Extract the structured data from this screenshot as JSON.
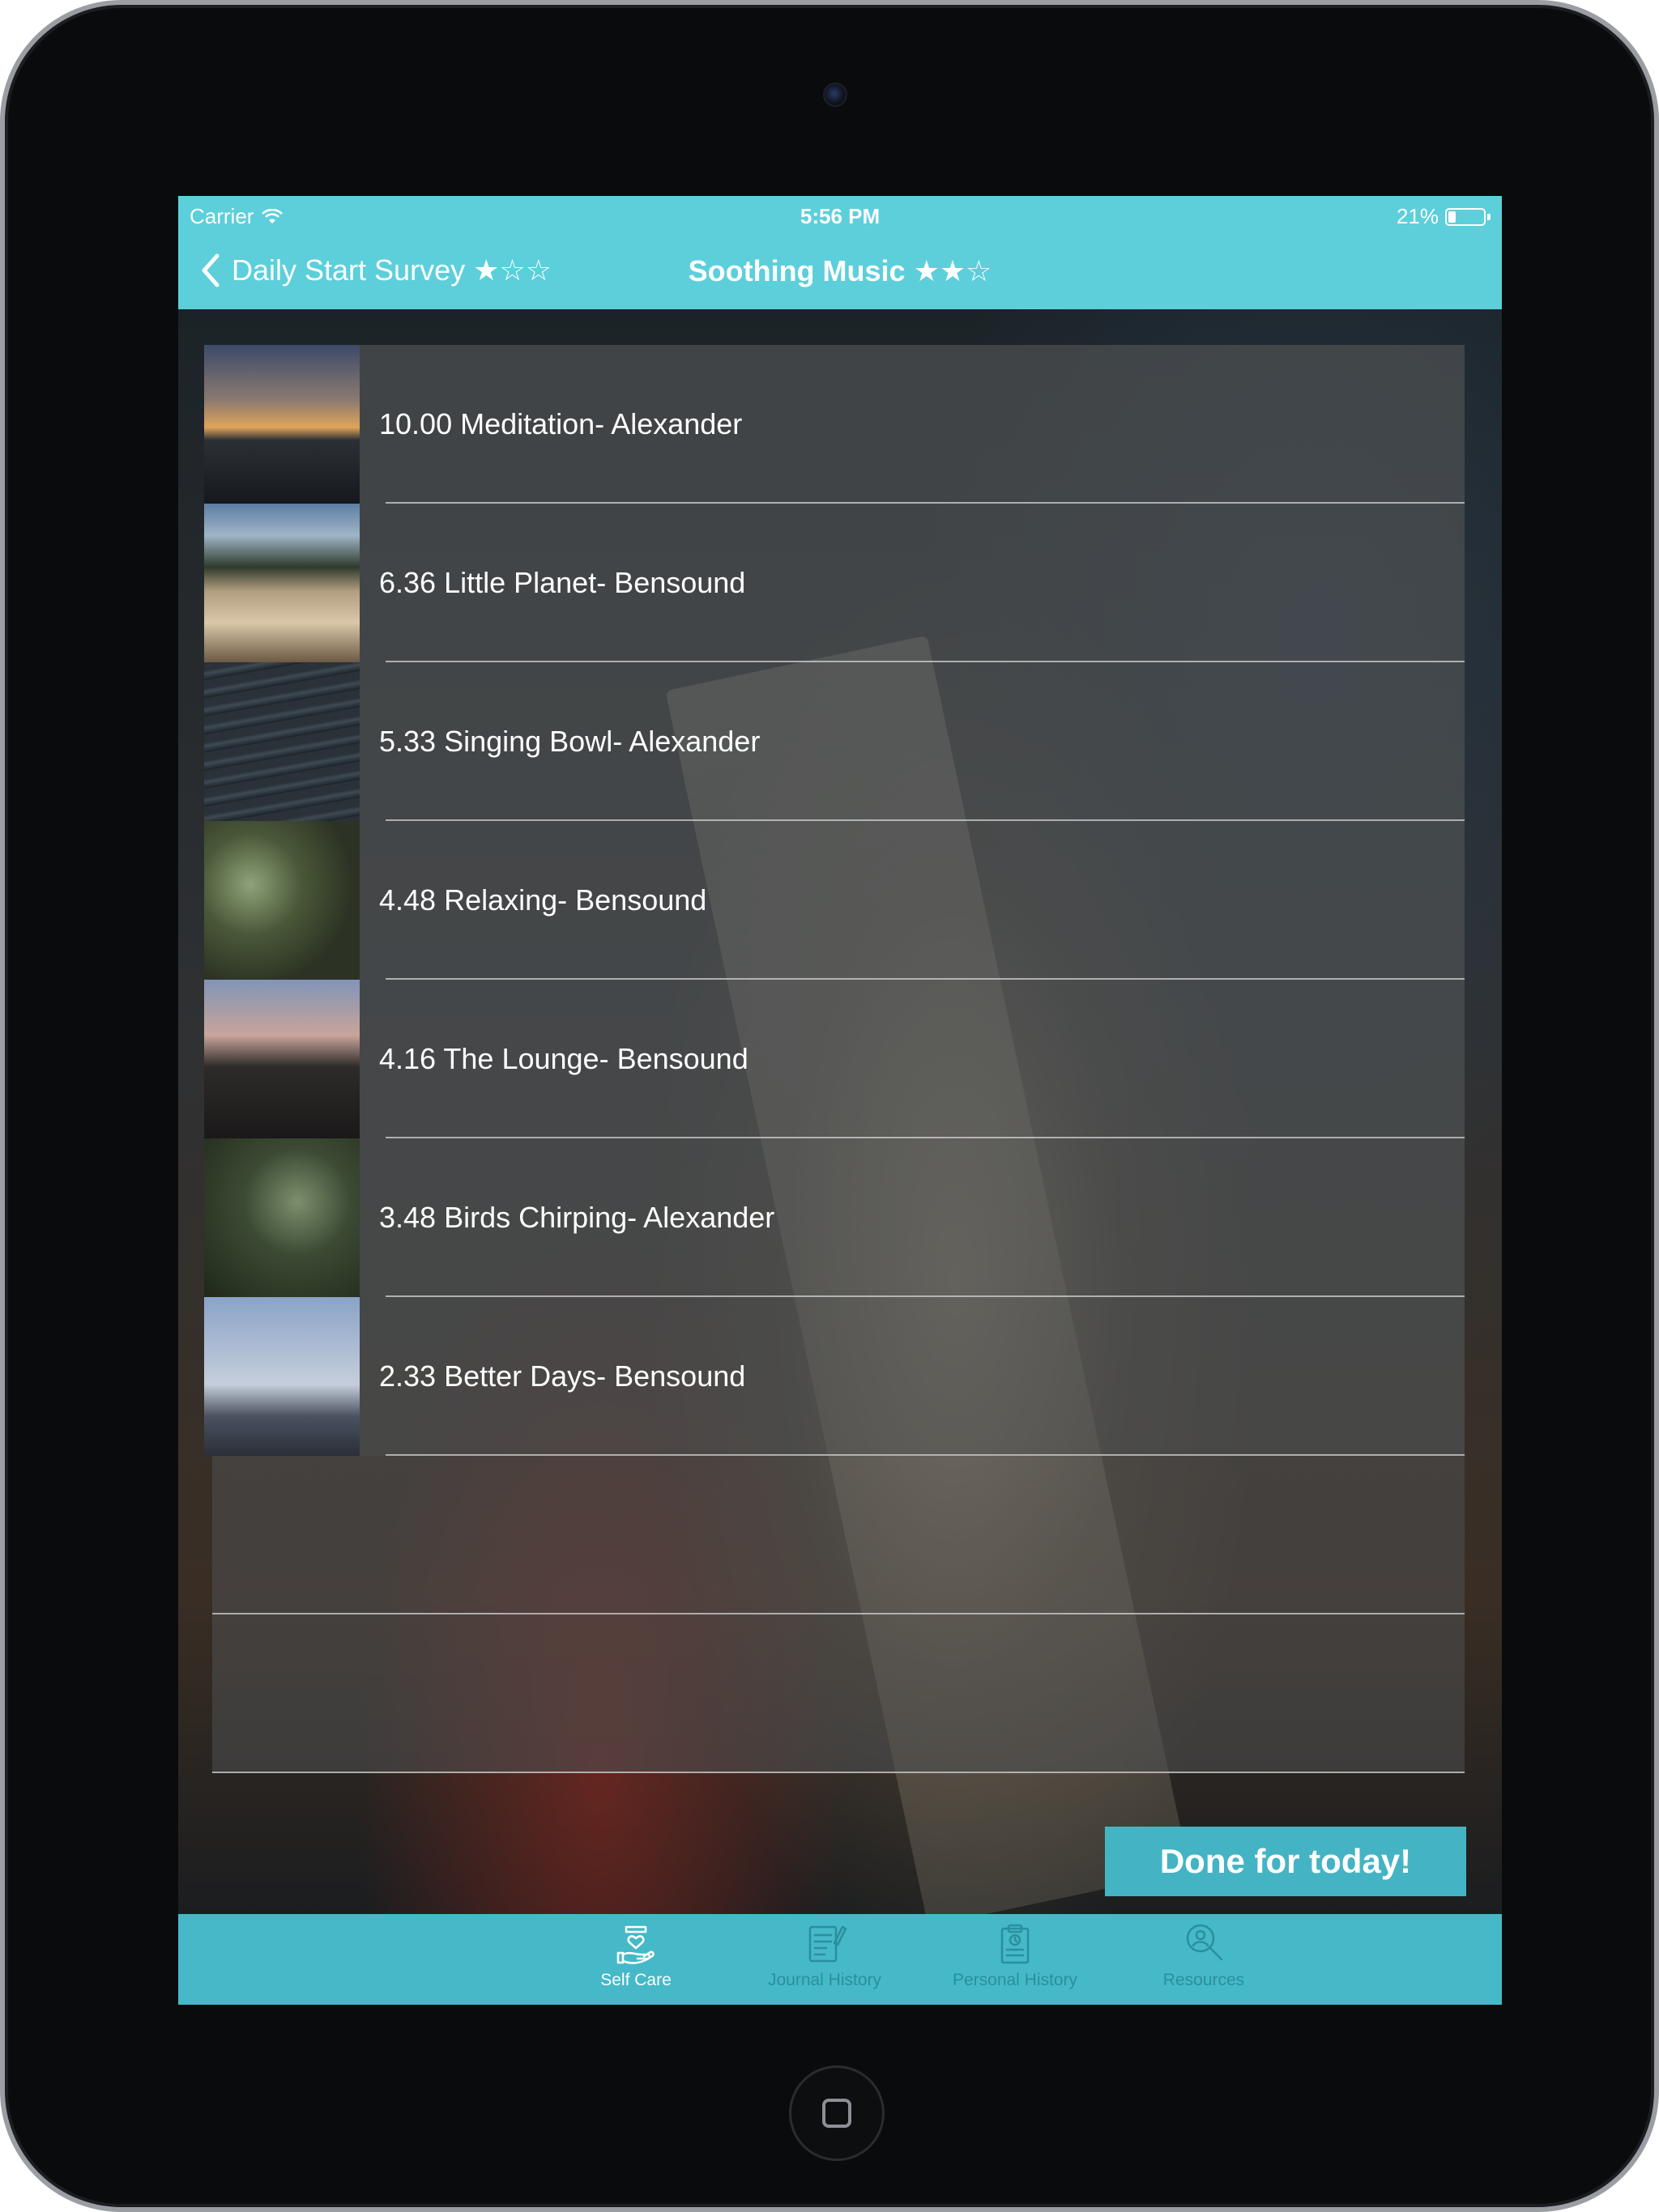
{
  "status_bar": {
    "carrier": "Carrier",
    "time": "5:56 PM",
    "battery": "21%",
    "battery_level": 0.21
  },
  "nav": {
    "back_label": "Daily Start Survey ★☆☆",
    "title": "Soothing Music ★★☆"
  },
  "tracks": [
    {
      "label": "10.00 Meditation- Alexander"
    },
    {
      "label": "6.36 Little Planet- Bensound"
    },
    {
      "label": "5.33 Singing Bowl- Alexander"
    },
    {
      "label": "4.48 Relaxing- Bensound"
    },
    {
      "label": "4.16 The Lounge- Bensound"
    },
    {
      "label": "3.48 Birds Chirping- Alexander"
    },
    {
      "label": "2.33 Better Days- Bensound"
    }
  ],
  "done_button": "Done for today!",
  "tabs": [
    {
      "label": "Self Care",
      "icon": "hand-heart-icon",
      "active": true
    },
    {
      "label": "Journal History",
      "icon": "notepad-icon",
      "active": false
    },
    {
      "label": "Personal History",
      "icon": "clipboard-clock-icon",
      "active": false
    },
    {
      "label": "Resources",
      "icon": "search-person-icon",
      "active": false
    }
  ],
  "colors": {
    "accent": "#5ccfdb",
    "tab_bar": "#45b9c8",
    "button": "#44b4c4",
    "tab_inactive": "#2b8f9f"
  }
}
